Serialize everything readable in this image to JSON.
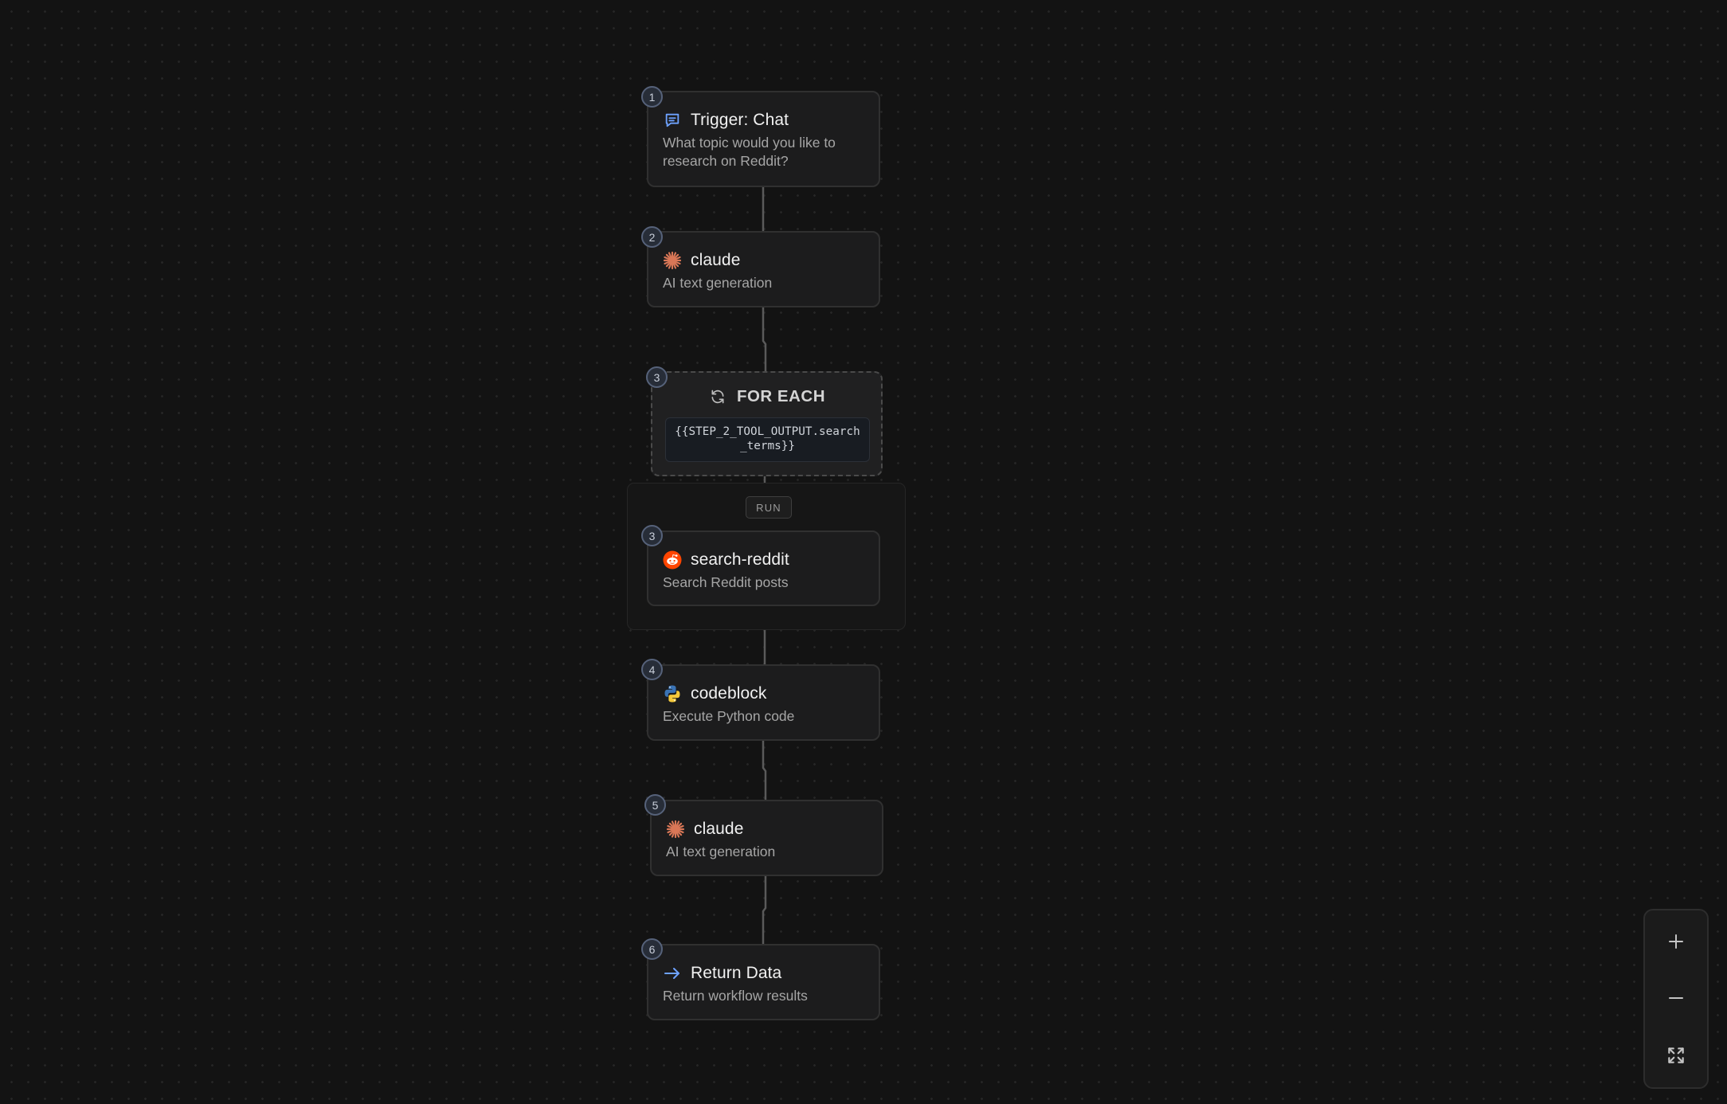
{
  "workflow": {
    "nodes": [
      {
        "step": "1",
        "icon": "chat-icon",
        "title": "Trigger: Chat",
        "subtitle": "What topic would you like to research on Reddit?"
      },
      {
        "step": "2",
        "icon": "claude-icon",
        "title": "claude",
        "subtitle": "AI text generation"
      },
      {
        "step": "3",
        "icon": "reddit-icon",
        "title": "search-reddit",
        "subtitle": "Search Reddit posts"
      },
      {
        "step": "4",
        "icon": "python-icon",
        "title": "codeblock",
        "subtitle": "Execute Python code"
      },
      {
        "step": "5",
        "icon": "claude-icon",
        "title": "claude",
        "subtitle": "AI text generation"
      },
      {
        "step": "6",
        "icon": "arrow-right-icon",
        "title": "Return Data",
        "subtitle": "Return workflow results"
      }
    ],
    "loop": {
      "step": "3",
      "icon": "refresh-icon",
      "title": "FOR EACH",
      "expression": "{{STEP_2_TOOL_OUTPUT.search_terms}}",
      "run_label": "RUN"
    }
  },
  "controls": {
    "zoom_in": "zoom-in-icon",
    "zoom_out": "zoom-out-icon",
    "fit_view": "fit-view-icon"
  },
  "colors": {
    "background": "#131313",
    "node": "#1c1c1d",
    "claude": "#d97757",
    "reddit": "#ff4500",
    "chat_icon": "#6ea2ff",
    "return_arrow": "#6ea2ff"
  }
}
